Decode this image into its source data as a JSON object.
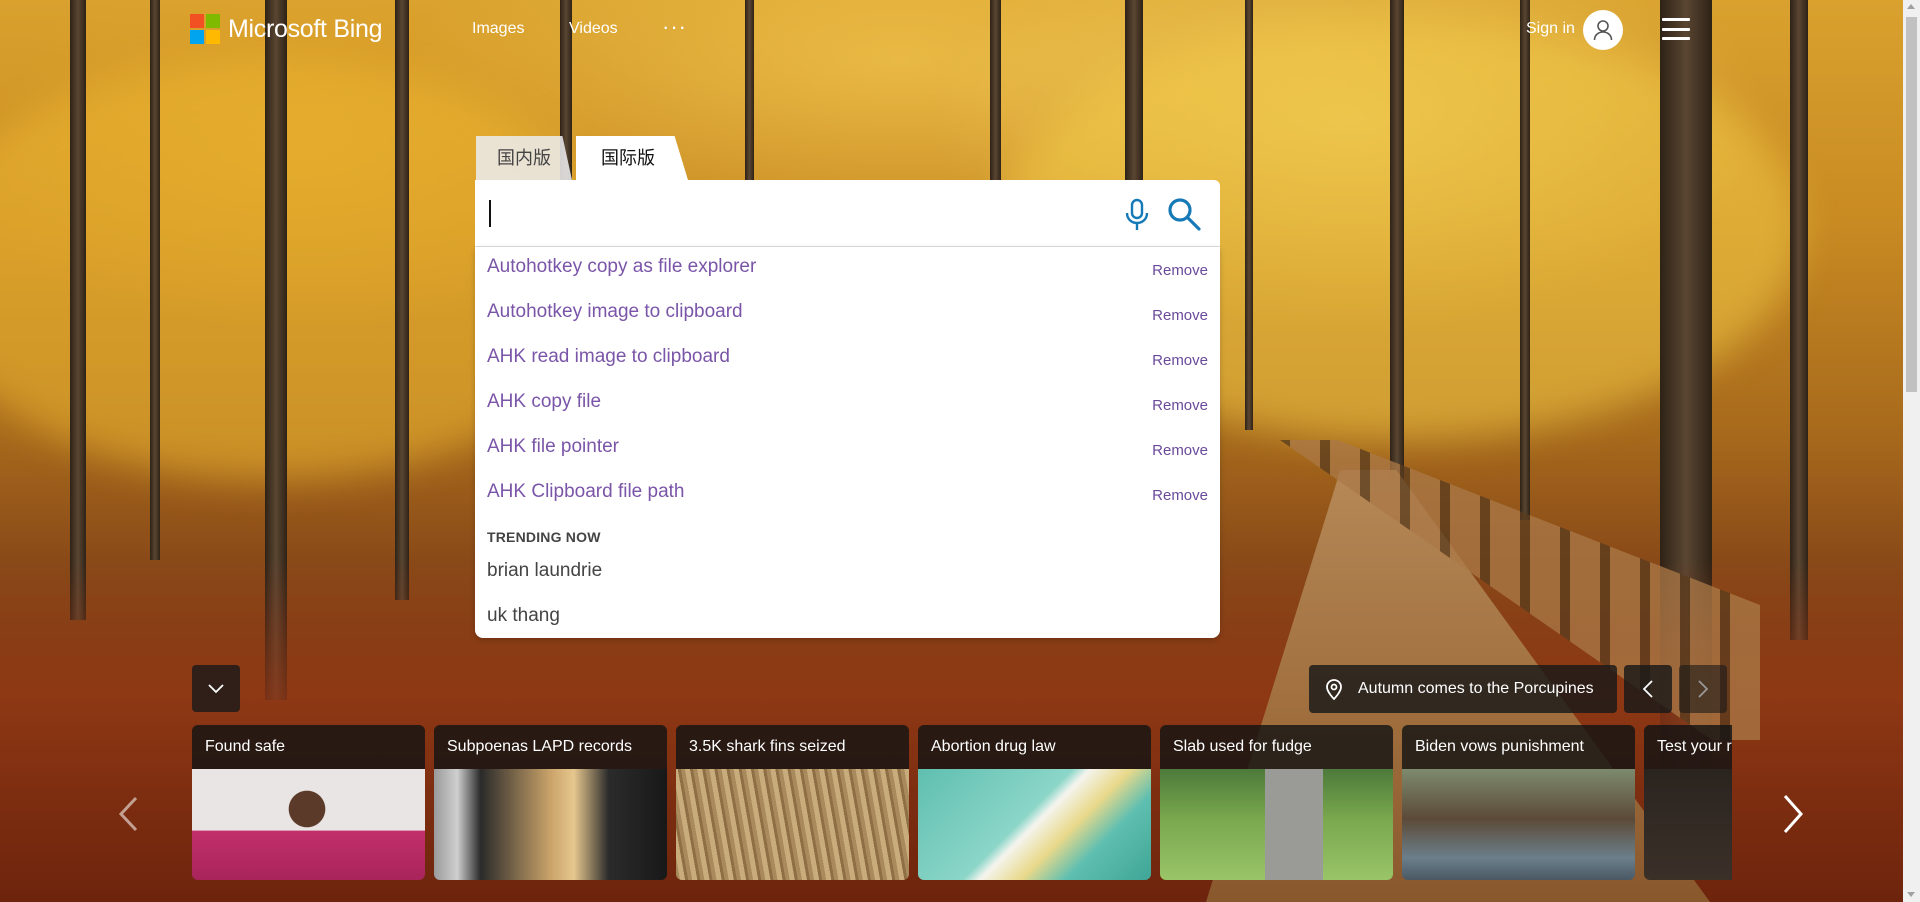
{
  "header": {
    "logo_text": "Microsoft Bing",
    "nav": {
      "images": "Images",
      "videos": "Videos",
      "more": "···"
    },
    "sign_in": "Sign in"
  },
  "brand_colors": {
    "red": "#f25022",
    "green": "#7fba00",
    "blue": "#00a4ef",
    "yellow": "#ffb900",
    "accent": "#177ab8"
  },
  "search": {
    "tabs": [
      {
        "label": "国内版",
        "active": false
      },
      {
        "label": "国际版",
        "active": true
      }
    ],
    "value": "",
    "history": [
      {
        "text": "Autohotkey copy as file explorer",
        "action": "Remove"
      },
      {
        "text": "Autohotkey image to clipboard",
        "action": "Remove"
      },
      {
        "text": "AHK read image to clipboard",
        "action": "Remove"
      },
      {
        "text": "AHK copy file",
        "action": "Remove"
      },
      {
        "text": "AHK file pointer",
        "action": "Remove"
      },
      {
        "text": "AHK Clipboard file path",
        "action": "Remove"
      }
    ],
    "trending_heading": "TRENDING NOW",
    "trending": [
      "brian laundrie",
      "uk thang"
    ]
  },
  "image_info": {
    "caption": "Autumn comes to the Porcupines",
    "icon": "location-pin-icon"
  },
  "news": [
    {
      "title": "Found safe"
    },
    {
      "title": "Subpoenas LAPD records"
    },
    {
      "title": "3.5K shark fins seized"
    },
    {
      "title": "Abortion drug law"
    },
    {
      "title": "Slab used for fudge"
    },
    {
      "title": "Biden vows punishment"
    },
    {
      "title": "Test your r"
    }
  ]
}
